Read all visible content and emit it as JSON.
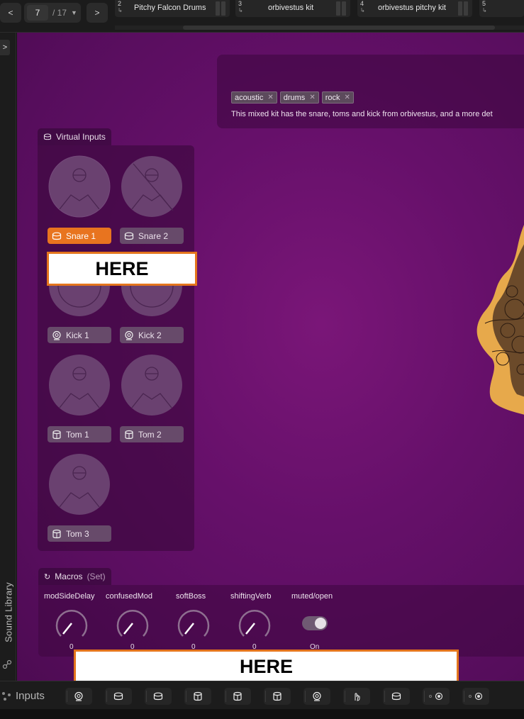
{
  "topbar": {
    "prev_label": "<",
    "next_label": ">",
    "page_current": "7",
    "page_total": "/ 17",
    "slots": [
      {
        "number": "2",
        "title": "Pitchy Falcon Drums"
      },
      {
        "number": "3",
        "title": "orbivestus kit"
      },
      {
        "number": "4",
        "title": "orbivestus pitchy kit"
      },
      {
        "number": "5",
        "title": ""
      }
    ]
  },
  "left_strip": {
    "expand_label": ">",
    "sound_library_label": "Sound Library"
  },
  "info": {
    "tags": [
      "acoustic",
      "drums",
      "rock"
    ],
    "description": "This mixed kit has the snare, toms and kick from orbivestus, and a more det"
  },
  "virtual_inputs": {
    "title": "Virtual Inputs",
    "pads": [
      {
        "label": "Snare 1",
        "icon": "snare-drum-icon",
        "active": true
      },
      {
        "label": "Snare 2",
        "icon": "snare-drum-icon",
        "active": false
      },
      {
        "label": "Kick 1",
        "icon": "kick-drum-icon",
        "active": false
      },
      {
        "label": "Kick 2",
        "icon": "kick-drum-icon",
        "active": false
      },
      {
        "label": "Tom 1",
        "icon": "tom-drum-icon",
        "active": false
      },
      {
        "label": "Tom 2",
        "icon": "tom-drum-icon",
        "active": false
      },
      {
        "label": "Tom 3",
        "icon": "tom-drum-icon",
        "active": false
      }
    ]
  },
  "macros": {
    "title": "Macros",
    "set_label": "(Set)",
    "items": [
      {
        "label": "modSideDelay",
        "value": "0"
      },
      {
        "label": "confusedMod",
        "value": "0"
      },
      {
        "label": "softBoss",
        "value": "0"
      },
      {
        "label": "shiftingVerb",
        "value": "0"
      },
      {
        "label": "muted/open",
        "value": "On"
      }
    ]
  },
  "redaction": {
    "top": "HERE",
    "bottom": "HERE"
  },
  "bottom": {
    "inputs_label": "Inputs",
    "buttons": [
      "kick-drum-icon",
      "snare-drum-icon",
      "snare-drum-icon",
      "tom-drum-icon",
      "tom-drum-icon",
      "tom-drum-icon",
      "kick-drum-icon",
      "hand-icon",
      "snare-drum-icon",
      "radio-dot-icon",
      "radio-dot-icon"
    ]
  },
  "colors": {
    "accent": "#e8741f",
    "background": "#66106a"
  }
}
